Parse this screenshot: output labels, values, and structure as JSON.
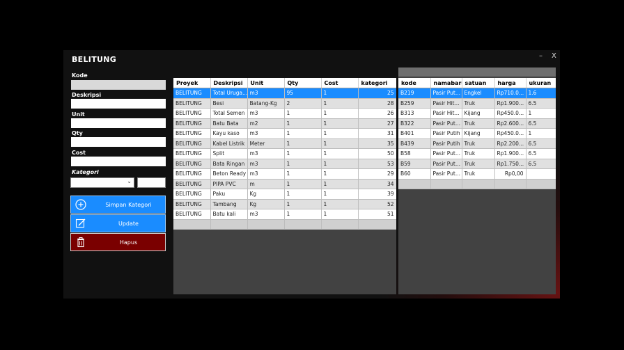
{
  "window": {
    "title": "BELITUNG",
    "minimize": "–",
    "close": "X"
  },
  "form": {
    "kode_label": "Kode",
    "deskripsi_label": "Deskripsi",
    "unit_label": "Unit",
    "qty_label": "Qty",
    "cost_label": "Cost",
    "kategori_label": "Kategori"
  },
  "buttons": {
    "simpan": "Simpan Kategori",
    "update": "Update",
    "hapus": "Hapus"
  },
  "grid1": {
    "columns": [
      "Proyek",
      "Deskripsi",
      "Unit",
      "Qty",
      "Cost",
      "kategori"
    ],
    "rows": [
      [
        "BELITUNG",
        "Total Uruga...",
        "m3",
        "95",
        "1",
        "25"
      ],
      [
        "BELITUNG",
        "Besi",
        "Batang-Kg",
        "2",
        "1",
        "28"
      ],
      [
        "BELITUNG",
        "Total Semen",
        "m3",
        "1",
        "1",
        "26"
      ],
      [
        "BELITUNG",
        "Batu Bata",
        "m2",
        "1",
        "1",
        "27"
      ],
      [
        "BELITUNG",
        "Kayu kaso",
        "m3",
        "1",
        "1",
        "31"
      ],
      [
        "BELITUNG",
        "Kabel Listrik",
        "Meter",
        "1",
        "1",
        "35"
      ],
      [
        "BELITUNG",
        "Split",
        "m3",
        "1",
        "1",
        "50"
      ],
      [
        "BELITUNG",
        "Bata Ringan",
        "m3",
        "1",
        "1",
        "53"
      ],
      [
        "BELITUNG",
        "Beton Ready",
        "m3",
        "1",
        "1",
        "29"
      ],
      [
        "BELITUNG",
        "PIPA PVC",
        "m",
        "1",
        "1",
        "34"
      ],
      [
        "BELITUNG",
        "Paku",
        "Kg",
        "1",
        "1",
        "39"
      ],
      [
        "BELITUNG",
        "Tambang",
        "Kg",
        "1",
        "1",
        "52"
      ],
      [
        "BELITUNG",
        "Batu kali",
        "m3",
        "1",
        "1",
        "51"
      ]
    ]
  },
  "grid2": {
    "columns": [
      "kode",
      "namabarang",
      "satuan",
      "harga",
      "ukuran"
    ],
    "rows": [
      [
        "B219",
        "Pasir Put...",
        "Engkel",
        "Rp710.0...",
        "1.6"
      ],
      [
        "B259",
        "Pasir Hit...",
        "Truk",
        "Rp1.900...",
        "6.5"
      ],
      [
        "B313",
        "Pasir Hit...",
        "Kijang",
        "Rp450.0...",
        "1"
      ],
      [
        "B322",
        "Pasir Put...",
        "Truk",
        "Rp2.600...",
        "6.5"
      ],
      [
        "B401",
        "Pasir Putih",
        "Kijang",
        "Rp450.0...",
        "1"
      ],
      [
        "B439",
        "Pasir Putih",
        "Truk",
        "Rp2.200...",
        "6.5"
      ],
      [
        "B58",
        "Pasir Put...",
        "Truk",
        "Rp1.900...",
        "6.5"
      ],
      [
        "B59",
        "Pasir Put...",
        "Truk",
        "Rp1.750...",
        "6.5"
      ],
      [
        "B60",
        "Pasir Put...",
        "Truk",
        "Rp0,00",
        ""
      ]
    ]
  },
  "icons": {
    "simpan": "plus-circle-icon",
    "update": "edit-icon",
    "hapus": "trash-icon"
  },
  "colors": {
    "accent": "#1a8cff",
    "danger": "#7a0000"
  }
}
